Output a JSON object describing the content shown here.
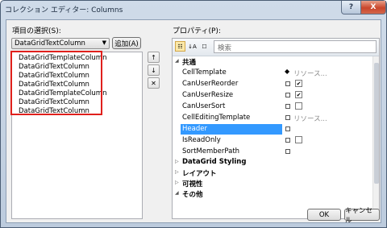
{
  "window": {
    "title": "コレクション エディター: Columns",
    "help_label": "?",
    "close_label": "X"
  },
  "left": {
    "items_label": "項目の選択(S):",
    "type_combo_value": "DataGridTextColumn",
    "add_button": "追加(A)",
    "items": [
      "DataGridTemplateColumn",
      "DataGridTextColumn",
      "DataGridTextColumn",
      "DataGridTextColumn",
      "DataGridTemplateColumn",
      "DataGridTextColumn",
      "DataGridTextColumn"
    ],
    "move_up_icon": "↑",
    "move_down_icon": "↓",
    "delete_icon": "✕"
  },
  "right": {
    "properties_label": "プロパティ(P):",
    "search_placeholder": "検索",
    "categories": [
      {
        "label": "共通",
        "expanded": true,
        "rows": [
          {
            "name": "CellTemplate",
            "marker": "diamond",
            "value": "リソース..."
          },
          {
            "name": "CanUserReorder",
            "marker": "box",
            "check": true
          },
          {
            "name": "CanUserResize",
            "marker": "box",
            "check": true
          },
          {
            "name": "CanUserSort",
            "marker": "box",
            "check": false
          },
          {
            "name": "CellEditingTemplate",
            "marker": "box",
            "value": "リソース..."
          },
          {
            "name": "Header",
            "marker": "box",
            "selected": true
          },
          {
            "name": "IsReadOnly",
            "marker": "box",
            "check": false
          },
          {
            "name": "SortMemberPath",
            "marker": "box"
          }
        ]
      },
      {
        "label": "DataGrid Styling",
        "expanded": false,
        "rows": []
      },
      {
        "label": "レイアウト",
        "expanded": false,
        "rows": []
      },
      {
        "label": "可視性",
        "expanded": false,
        "rows": []
      },
      {
        "label": "その他",
        "expanded": true,
        "rows": []
      }
    ]
  },
  "footer": {
    "ok": "OK",
    "cancel": "キャンセル"
  }
}
